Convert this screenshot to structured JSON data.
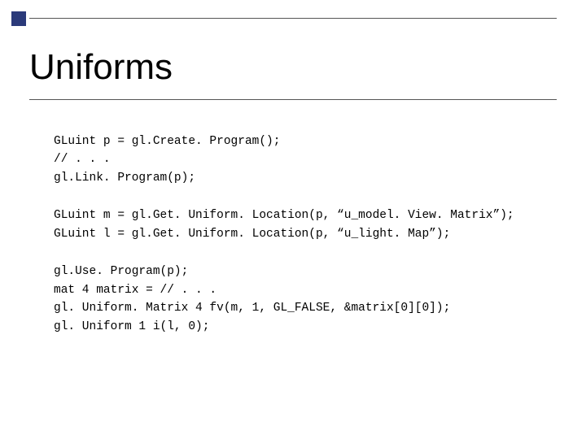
{
  "title": "Uniforms",
  "code": {
    "block1": "GLuint p = gl.Create. Program();\n// . . .\ngl.Link. Program(p);",
    "block2": "GLuint m = gl.Get. Uniform. Location(p, “u_model. View. Matrix”);\nGLuint l = gl.Get. Uniform. Location(p, “u_light. Map”);",
    "block3": "gl.Use. Program(p);\nmat 4 matrix = // . . .\ngl. Uniform. Matrix 4 fv(m, 1, GL_FALSE, &matrix[0][0]);\ngl. Uniform 1 i(l, 0);"
  }
}
